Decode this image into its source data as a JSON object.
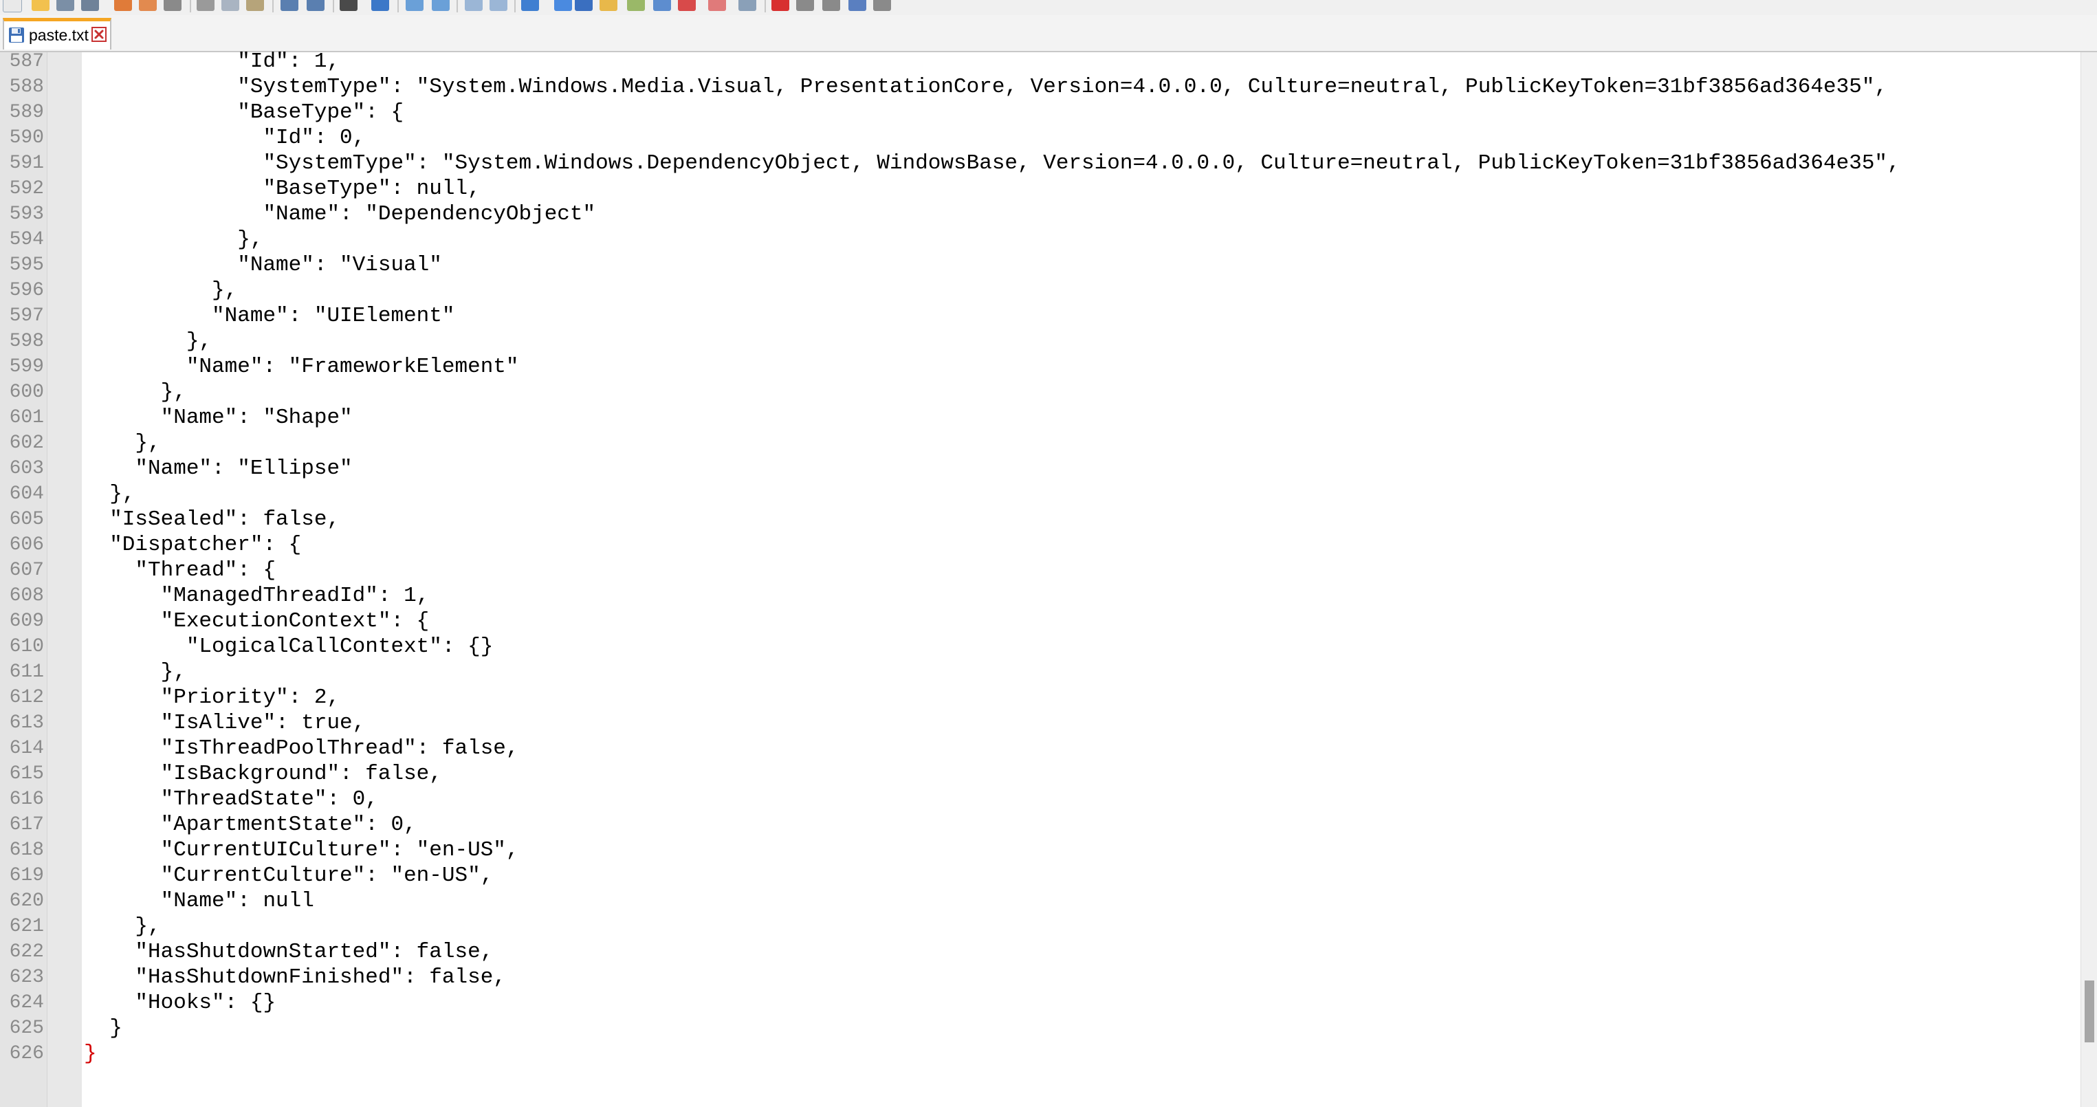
{
  "tab": {
    "label": "paste.txt",
    "save_icon": "floppy-disk-icon",
    "close_icon": "close-icon"
  },
  "colors": {
    "tab_accent": "#f5a623",
    "closing_brace": "#d40000",
    "gutter_bg": "#e4e4e4"
  },
  "editor": {
    "lines": [
      {
        "num": "587",
        "text": "            \"Id\": 1,"
      },
      {
        "num": "588",
        "text": "            \"SystemType\": \"System.Windows.Media.Visual, PresentationCore, Version=4.0.0.0, Culture=neutral, PublicKeyToken=31bf3856ad364e35\","
      },
      {
        "num": "589",
        "text": "            \"BaseType\": {"
      },
      {
        "num": "590",
        "text": "              \"Id\": 0,"
      },
      {
        "num": "591",
        "text": "              \"SystemType\": \"System.Windows.DependencyObject, WindowsBase, Version=4.0.0.0, Culture=neutral, PublicKeyToken=31bf3856ad364e35\","
      },
      {
        "num": "592",
        "text": "              \"BaseType\": null,"
      },
      {
        "num": "593",
        "text": "              \"Name\": \"DependencyObject\""
      },
      {
        "num": "594",
        "text": "            },"
      },
      {
        "num": "595",
        "text": "            \"Name\": \"Visual\""
      },
      {
        "num": "596",
        "text": "          },"
      },
      {
        "num": "597",
        "text": "          \"Name\": \"UIElement\""
      },
      {
        "num": "598",
        "text": "        },"
      },
      {
        "num": "599",
        "text": "        \"Name\": \"FrameworkElement\""
      },
      {
        "num": "600",
        "text": "      },"
      },
      {
        "num": "601",
        "text": "      \"Name\": \"Shape\""
      },
      {
        "num": "602",
        "text": "    },"
      },
      {
        "num": "603",
        "text": "    \"Name\": \"Ellipse\""
      },
      {
        "num": "604",
        "text": "  },"
      },
      {
        "num": "605",
        "text": "  \"IsSealed\": false,"
      },
      {
        "num": "606",
        "text": "  \"Dispatcher\": {"
      },
      {
        "num": "607",
        "text": "    \"Thread\": {"
      },
      {
        "num": "608",
        "text": "      \"ManagedThreadId\": 1,"
      },
      {
        "num": "609",
        "text": "      \"ExecutionContext\": {"
      },
      {
        "num": "610",
        "text": "        \"LogicalCallContext\": {}"
      },
      {
        "num": "611",
        "text": "      },"
      },
      {
        "num": "612",
        "text": "      \"Priority\": 2,"
      },
      {
        "num": "613",
        "text": "      \"IsAlive\": true,"
      },
      {
        "num": "614",
        "text": "      \"IsThreadPoolThread\": false,"
      },
      {
        "num": "615",
        "text": "      \"IsBackground\": false,"
      },
      {
        "num": "616",
        "text": "      \"ThreadState\": 0,"
      },
      {
        "num": "617",
        "text": "      \"ApartmentState\": 0,"
      },
      {
        "num": "618",
        "text": "      \"CurrentUICulture\": \"en-US\","
      },
      {
        "num": "619",
        "text": "      \"CurrentCulture\": \"en-US\","
      },
      {
        "num": "620",
        "text": "      \"Name\": null"
      },
      {
        "num": "621",
        "text": "    },"
      },
      {
        "num": "622",
        "text": "    \"HasShutdownStarted\": false,"
      },
      {
        "num": "623",
        "text": "    \"HasShutdownFinished\": false,"
      },
      {
        "num": "624",
        "text": "    \"Hooks\": {}"
      },
      {
        "num": "625",
        "text": "  }"
      },
      {
        "num": "626",
        "text": "}",
        "highlight": true
      }
    ]
  }
}
